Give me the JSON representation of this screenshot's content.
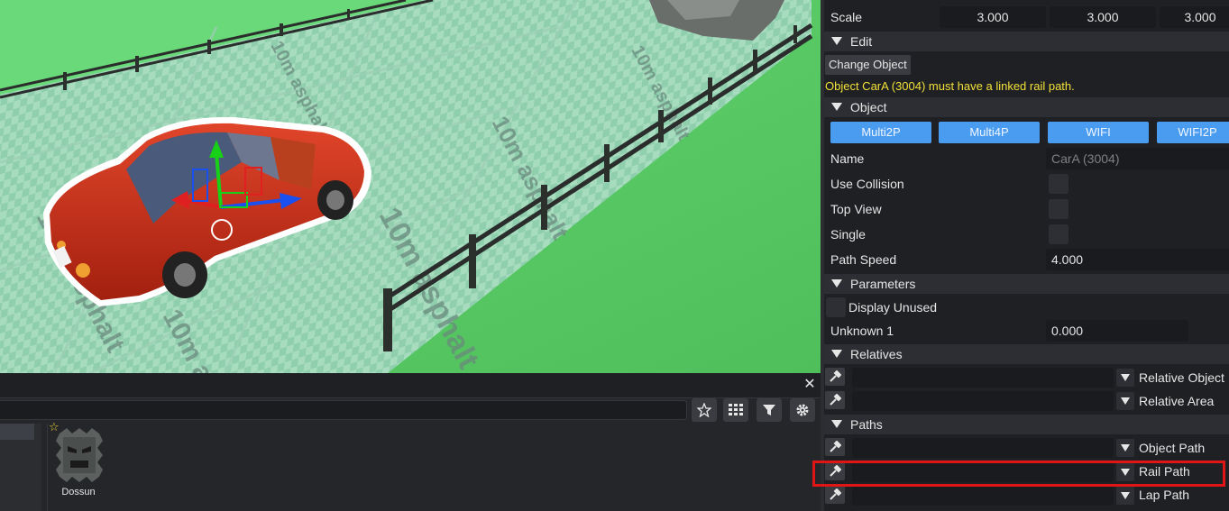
{
  "viewport": {
    "road_text": "10m asphalt"
  },
  "browser": {
    "close_icon": "close-icon",
    "toolbar_icons": [
      "star-icon",
      "grid-icon",
      "filter-icon",
      "gear-icon"
    ],
    "assets": [
      {
        "label": "Dossun",
        "favorite": true
      }
    ]
  },
  "props": {
    "scale": {
      "label": "Scale",
      "x": "3.000",
      "y": "3.000",
      "z": "3.000"
    },
    "edit": {
      "header": "Edit",
      "change_object": "Change Object",
      "warning": "Object CarA (3004) must have a linked rail path."
    },
    "object": {
      "header": "Object",
      "modes": [
        "Multi2P",
        "Multi4P",
        "WIFI",
        "WIFI2P"
      ],
      "name_label": "Name",
      "name_value": "CarA (3004)",
      "use_collision": "Use Collision",
      "top_view": "Top View",
      "single": "Single",
      "path_speed_label": "Path Speed",
      "path_speed_value": "4.000"
    },
    "parameters": {
      "header": "Parameters",
      "display_unused": "Display Unused",
      "unknown1_label": "Unknown 1",
      "unknown1_value": "0.000"
    },
    "relatives": {
      "header": "Relatives",
      "relative_object": "Relative Object",
      "relative_area": "Relative Area"
    },
    "paths": {
      "header": "Paths",
      "object_path": "Object Path",
      "rail_path": "Rail Path",
      "lap_path": "Lap Path"
    }
  },
  "colors": {
    "accent_blue": "#4a9cf0",
    "warning_yellow": "#f2e03a",
    "highlight_red": "#e01515",
    "car_red": "#c8321c"
  }
}
